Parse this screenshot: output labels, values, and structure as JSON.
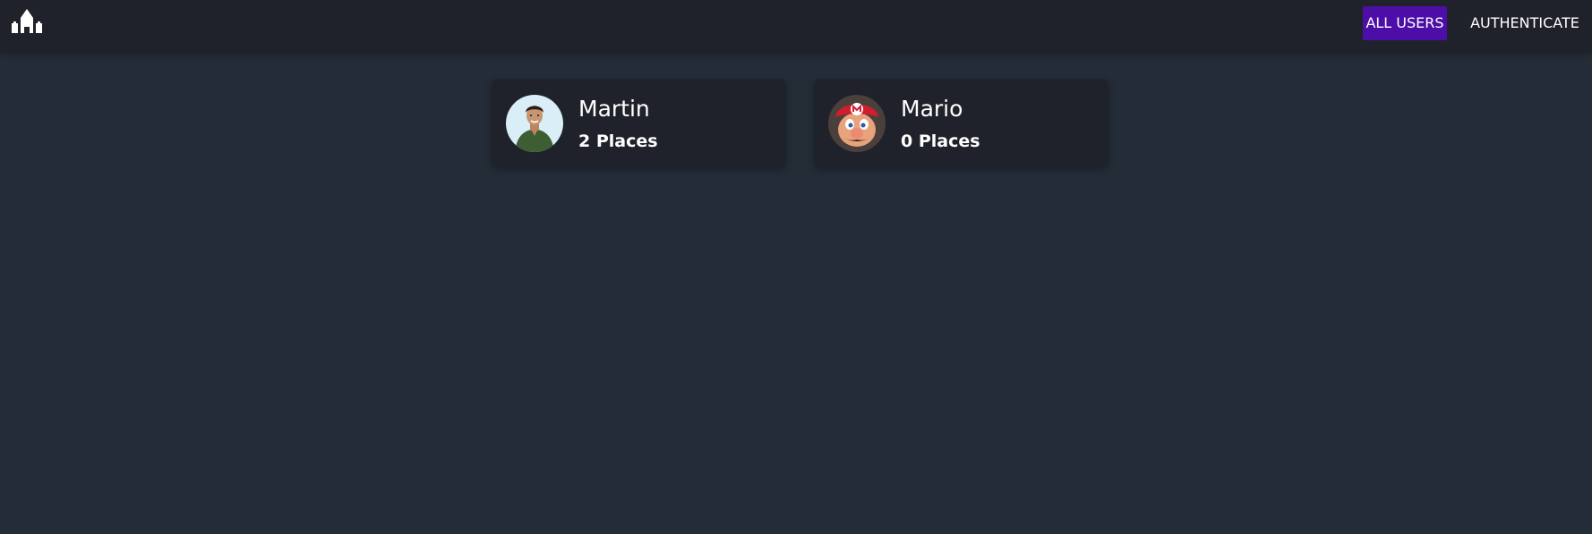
{
  "header": {
    "logo_icon": "town-buildings-icon",
    "nav": {
      "all_users": "ALL USERS",
      "authenticate": "AUTHENTICATE"
    },
    "active_color": "#4c0ea6"
  },
  "users": [
    {
      "name": "Martin",
      "places": "2 Places",
      "avatar": "man-green-shirt-photo"
    },
    {
      "name": "Mario",
      "places": "0 Places",
      "avatar": "mario-character-photo"
    }
  ]
}
